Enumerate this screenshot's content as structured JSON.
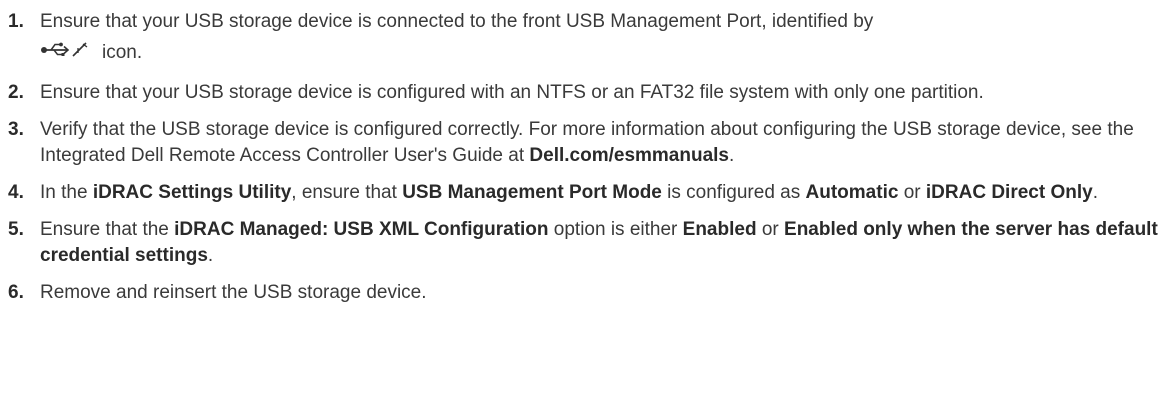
{
  "steps": [
    {
      "number": "1.",
      "text_before_icon": "Ensure that your USB storage device is connected to the front USB Management Port, identified by",
      "icon": "usb-management-port-icon",
      "text_after_icon": "icon."
    },
    {
      "number": "2.",
      "text": "Ensure that your USB storage device is configured with an NTFS or an FAT32 file system with only one partition."
    },
    {
      "number": "3.",
      "text_a": "Verify that the USB storage device is configured correctly. For more information about configuring the USB storage device, see the Integrated Dell Remote Access Controller User's Guide at ",
      "link_bold": "Dell.com/esmmanuals",
      "text_b": "."
    },
    {
      "number": "4.",
      "t1": "In the ",
      "b1": "iDRAC Settings Utility",
      "t2": ", ensure that ",
      "b2": "USB Management Port Mode",
      "t3": " is configured as ",
      "b3": "Automatic",
      "t4": " or ",
      "b4": "iDRAC Direct Only",
      "t5": "."
    },
    {
      "number": "5.",
      "t1": "Ensure that the ",
      "b1": "iDRAC Managed: USB XML Configuration",
      "t2": " option is either ",
      "b2": "Enabled",
      "t3": " or ",
      "b3": "Enabled only when the server has default credential settings",
      "t4": "."
    },
    {
      "number": "6.",
      "text": "Remove and reinsert the USB storage device."
    }
  ]
}
